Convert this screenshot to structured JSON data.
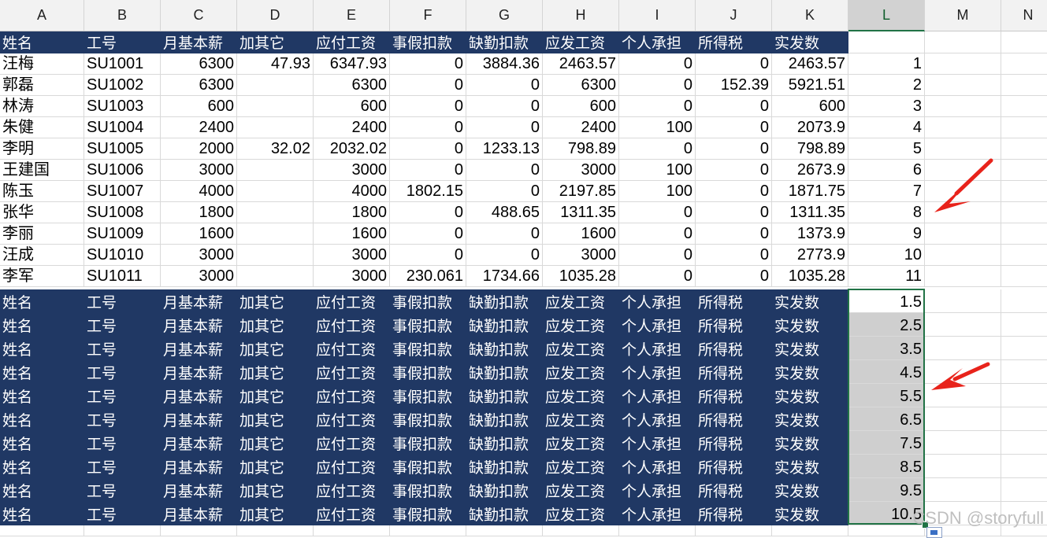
{
  "columns": [
    "A",
    "B",
    "C",
    "D",
    "E",
    "F",
    "G",
    "H",
    "I",
    "J",
    "K",
    "L",
    "M",
    "N"
  ],
  "selected_column": "L",
  "header_labels": [
    "姓名",
    "工号",
    "月基本薪",
    "加其它",
    "应付工资",
    "事假扣款",
    "缺勤扣款",
    "应发工资",
    "个人承担",
    "所得税",
    "实发数"
  ],
  "rows": [
    {
      "name": "汪梅",
      "id": "SU1001",
      "base": "6300",
      "other": "47.93",
      "payable": "6347.93",
      "leave": "0",
      "absence": "3884.36",
      "gross": "2463.57",
      "personal": "0",
      "tax": "0",
      "net": "2463.57",
      "l": "1"
    },
    {
      "name": "郭磊",
      "id": "SU1002",
      "base": "6300",
      "other": "",
      "payable": "6300",
      "leave": "0",
      "absence": "0",
      "gross": "6300",
      "personal": "0",
      "tax": "152.39",
      "net": "5921.51",
      "l": "2"
    },
    {
      "name": "林涛",
      "id": "SU1003",
      "base": "600",
      "other": "",
      "payable": "600",
      "leave": "0",
      "absence": "0",
      "gross": "600",
      "personal": "0",
      "tax": "0",
      "net": "600",
      "l": "3"
    },
    {
      "name": "朱健",
      "id": "SU1004",
      "base": "2400",
      "other": "",
      "payable": "2400",
      "leave": "0",
      "absence": "0",
      "gross": "2400",
      "personal": "100",
      "tax": "0",
      "net": "2073.9",
      "l": "4"
    },
    {
      "name": "李明",
      "id": "SU1005",
      "base": "2000",
      "other": "32.02",
      "payable": "2032.02",
      "leave": "0",
      "absence": "1233.13",
      "gross": "798.89",
      "personal": "0",
      "tax": "0",
      "net": "798.89",
      "l": "5"
    },
    {
      "name": "王建国",
      "id": "SU1006",
      "base": "3000",
      "other": "",
      "payable": "3000",
      "leave": "0",
      "absence": "0",
      "gross": "3000",
      "personal": "100",
      "tax": "0",
      "net": "2673.9",
      "l": "6"
    },
    {
      "name": "陈玉",
      "id": "SU1007",
      "base": "4000",
      "other": "",
      "payable": "4000",
      "leave": "1802.15",
      "absence": "0",
      "gross": "2197.85",
      "personal": "100",
      "tax": "0",
      "net": "1871.75",
      "l": "7"
    },
    {
      "name": "张华",
      "id": "SU1008",
      "base": "1800",
      "other": "",
      "payable": "1800",
      "leave": "0",
      "absence": "488.65",
      "gross": "1311.35",
      "personal": "0",
      "tax": "0",
      "net": "1311.35",
      "l": "8"
    },
    {
      "name": "李丽",
      "id": "SU1009",
      "base": "1600",
      "other": "",
      "payable": "1600",
      "leave": "0",
      "absence": "0",
      "gross": "1600",
      "personal": "0",
      "tax": "0",
      "net": "1373.9",
      "l": "9"
    },
    {
      "name": "汪成",
      "id": "SU1010",
      "base": "3000",
      "other": "",
      "payable": "3000",
      "leave": "0",
      "absence": "0",
      "gross": "3000",
      "personal": "0",
      "tax": "0",
      "net": "2773.9",
      "l": "10"
    },
    {
      "name": "李军",
      "id": "SU1011",
      "base": "3000",
      "other": "",
      "payable": "3000",
      "leave": "230.061",
      "absence": "1734.66",
      "gross": "1035.28",
      "personal": "0",
      "tax": "0",
      "net": "1035.28",
      "l": "11"
    }
  ],
  "helper_values": [
    "1.5",
    "2.5",
    "3.5",
    "4.5",
    "5.5",
    "6.5",
    "7.5",
    "8.5",
    "9.5",
    "10.5"
  ],
  "watermark": "CSDN @storyfull",
  "colors": {
    "header_bg": "#203864",
    "selection": "#217346",
    "arrow": "#e8231b"
  },
  "icons": {
    "paste_options": "paste-options-icon",
    "arrow": "red-arrow-icon"
  }
}
